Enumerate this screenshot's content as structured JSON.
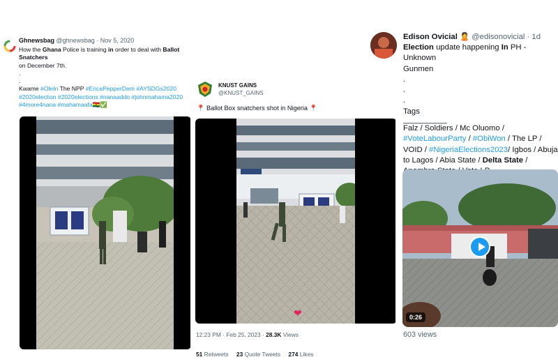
{
  "tweet1": {
    "name": "Ghnewsbag",
    "handle": "@ghnewsbag",
    "date": "Nov 5, 2020",
    "line1_pre": "How the ",
    "line1_bold1": "Ghana",
    "line1_mid": " Police is training ",
    "line1_bold2": "in",
    "line1_mid2": " order to deal with ",
    "line1_bold3": "Ballot Snatchers",
    "line2": "on December 7th.",
    "dot1": ".",
    "dot2": ".",
    "tags_pre": "Kwame ",
    "tag1": "#OleIn",
    "tags_mid": " The NPP ",
    "tag2": "#EricaPepperDem",
    "tag3": "#AYSDGs2020",
    "tag4": "#2020election",
    "tag5": "#2020elections",
    "tag6": "#nanaaddo",
    "tag7": "#johnmahama2020",
    "tag8": "#4more4nana",
    "tag9": "#mahamaafa",
    "emoji": "🇬🇭✅"
  },
  "tweet2": {
    "name": "KNUST GAINS",
    "handle": "@KNUST_GAINS",
    "caption": "📍 Ballot Box snatchers shot in Nigeria 📍",
    "time": "12:23 PM · Feb 25, 2023 · ",
    "views_count": "28.3K",
    "views_label": " Views",
    "retweets": "51",
    "retweets_label": "Retweets",
    "quotes": "23",
    "quotes_label": "Quote Tweets",
    "likes": "274",
    "likes_label": "Likes"
  },
  "tweet3": {
    "name": "Edison Ovicial",
    "badge": "🙎",
    "handle": "@edisonovicial",
    "age": "· 1d",
    "line1_bold": "Election",
    "line1_rest": " update happening ",
    "line1_in": "In",
    "line1_end": " PH - Unknown",
    "line2": "Gunmen",
    "dot1": ".",
    "dot2": ".",
    "dot3": ".",
    "tags_label": "Tags",
    "rule": "__________",
    "t_a": "Falz / Soldiers / Mc Oluomo /",
    "t_b1": "#VoteLabourParty",
    "t_b2": " / ",
    "t_b3": "#ObiWon",
    "t_b4": " / The LP /",
    "t_c1": "VOID / ",
    "t_c2": "#NigeriaElections2023",
    "t_c3": "/ Igbos / Abuja",
    "t_d1": "to Lagos  / Abia State / ",
    "t_d2": "Delta State",
    "t_d3": " /",
    "t_e": "Anambra State / Vote LP",
    "duration": "0:26",
    "views": "603 views"
  },
  "colors": {
    "link": "#1d9bf0",
    "text": "#0f1419",
    "muted": "#536471"
  },
  "icons": [
    "gh-logo-icon",
    "knust-logo-icon",
    "play-icon",
    "heart-icon"
  ]
}
